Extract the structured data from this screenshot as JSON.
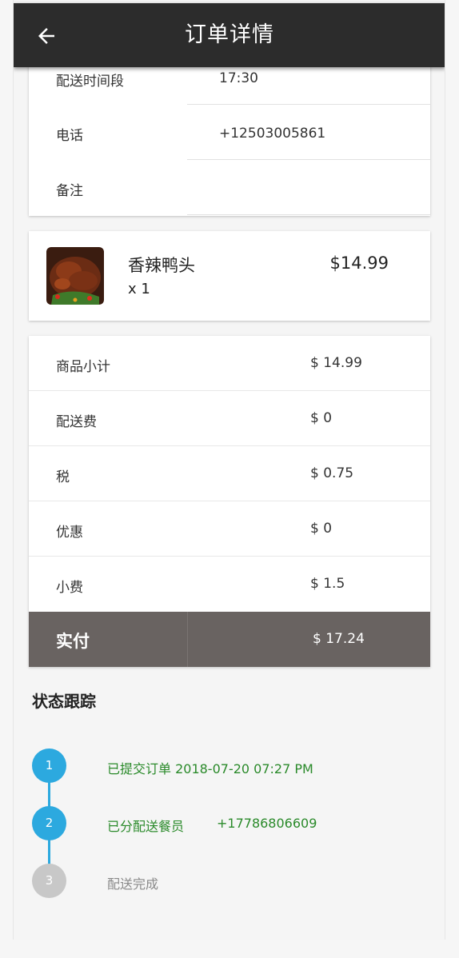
{
  "header": {
    "title": "订单详情",
    "back_icon": "arrow-left-icon"
  },
  "order_info": [
    {
      "label": "配送时间段",
      "value": "17:30"
    },
    {
      "label": "电话",
      "value": "+12503005861"
    },
    {
      "label": "备注",
      "value": ""
    }
  ],
  "item": {
    "name": "香辣鸭头",
    "quantity": "x 1",
    "price": "$14.99",
    "image": "spicy-duck-head-photo"
  },
  "totals": [
    {
      "label": "商品小计",
      "value": "$ 14.99"
    },
    {
      "label": "配送费",
      "value": "$ 0"
    },
    {
      "label": "税",
      "value": "$ 0.75"
    },
    {
      "label": "优惠",
      "value": "$ 0"
    },
    {
      "label": "小费",
      "value": "$ 1.5"
    }
  ],
  "paid": {
    "label": "实付",
    "value": "$ 17.24"
  },
  "tracking": {
    "title": "状态跟踪",
    "steps": [
      {
        "number": "1",
        "text": "已提交订单 2018-07-20 07:27 PM",
        "extra": "",
        "status": "done"
      },
      {
        "number": "2",
        "text": "已分配送餐员",
        "extra": "+17786806609",
        "status": "done"
      },
      {
        "number": "3",
        "text": "配送完成",
        "extra": "",
        "status": "pending"
      }
    ]
  },
  "colors": {
    "appbar": "#2c2c2c",
    "accent": "#2ca9df",
    "success_text": "#2a8a2a",
    "paid_bg": "#696361"
  }
}
